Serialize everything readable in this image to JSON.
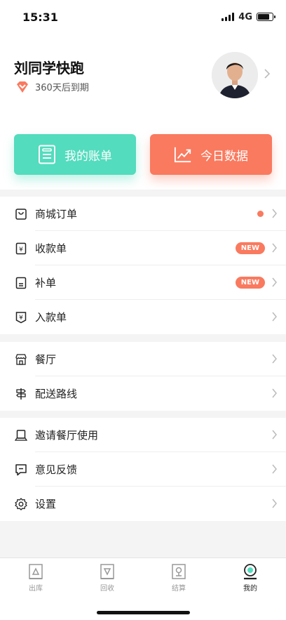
{
  "status": {
    "time": "15:31",
    "network": "4G"
  },
  "profile": {
    "name": "刘同学快跑",
    "membership": "360天后到期"
  },
  "cards": [
    {
      "label": "我的账单",
      "icon": "bill-icon",
      "color": "#53dcbd"
    },
    {
      "label": "今日数据",
      "icon": "trend-chart-icon",
      "color": "#f97a5f"
    }
  ],
  "menu": {
    "orders": [
      {
        "label": "商城订单",
        "icon": "shopping-bag-icon",
        "indicator": "dot"
      },
      {
        "label": "收款单",
        "icon": "receipt-yen-icon",
        "badge": "NEW"
      },
      {
        "label": "补单",
        "icon": "document-icon",
        "badge": "NEW"
      },
      {
        "label": "入款单",
        "icon": "deposit-yen-icon"
      }
    ],
    "business": [
      {
        "label": "餐厅",
        "icon": "store-icon"
      },
      {
        "label": "配送路线",
        "icon": "signpost-icon"
      }
    ],
    "other": [
      {
        "label": "邀请餐厅使用",
        "icon": "laptop-icon"
      },
      {
        "label": "意见反馈",
        "icon": "feedback-icon"
      },
      {
        "label": "设置",
        "icon": "settings-gear-icon"
      }
    ]
  },
  "tabs": [
    {
      "label": "出库",
      "icon": "outbound-icon",
      "active": false
    },
    {
      "label": "回收",
      "icon": "recycle-icon",
      "active": false
    },
    {
      "label": "结算",
      "icon": "settlement-icon",
      "active": false
    },
    {
      "label": "我的",
      "icon": "profile-icon",
      "active": true
    }
  ],
  "colors": {
    "accent_green": "#53dcbd",
    "accent_orange": "#f97a5f"
  }
}
